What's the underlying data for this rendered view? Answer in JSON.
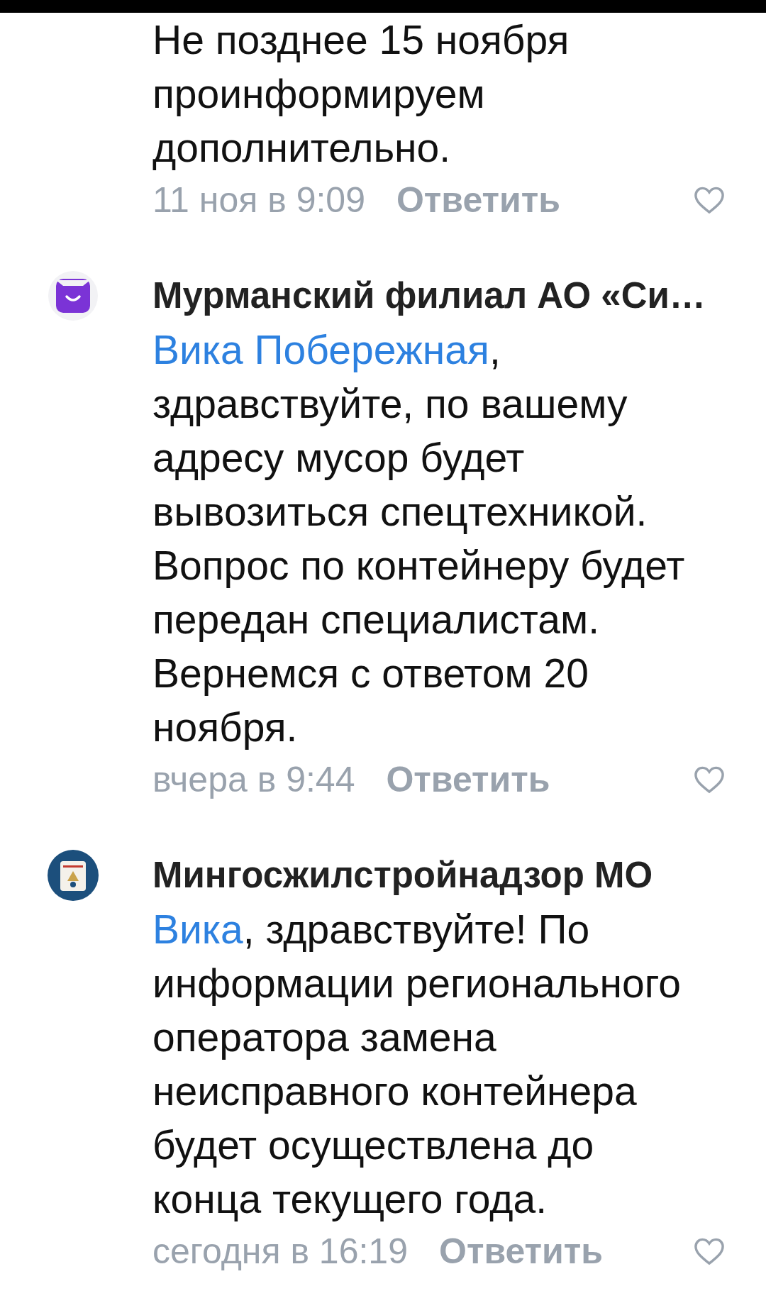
{
  "comments": [
    {
      "kind": "continuation",
      "text": "Не позднее 15 ноября проинформируем дополнительно.",
      "time": "11 ноя в 9:09",
      "reply": "Ответить"
    },
    {
      "kind": "smile",
      "author": "Мурманский филиал АО «Си…",
      "mention": "Вика Побережная",
      "text": ", здравствуйте, по вашему адресу мусор будет вывозиться спецтехникой. Вопрос по контейнеру будет передан специалистам. Вернемся с ответом 20 ноября.",
      "time": "вчера в 9:44",
      "reply": "Ответить"
    },
    {
      "kind": "emblem",
      "author": "Мингосжилстройнадзор МО",
      "mention": "Вика",
      "text": ", здравствуйте! По информации регионального оператора замена неисправного контейнера будет осуществлена до конца текущего года.",
      "time": "сегодня в 16:19",
      "reply": "Ответить"
    }
  ]
}
